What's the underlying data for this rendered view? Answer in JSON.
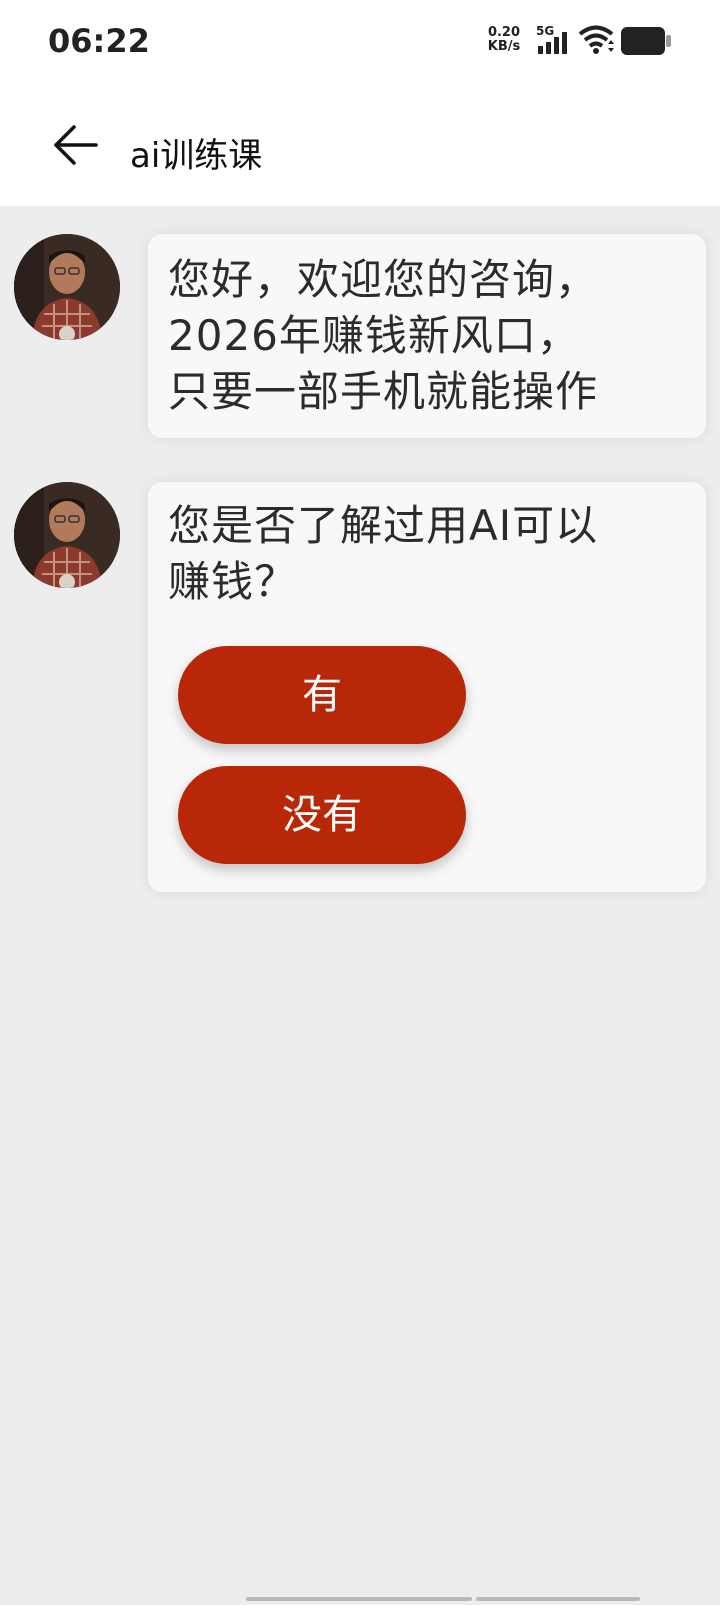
{
  "status_bar": {
    "time": "06:22",
    "net_speed_value": "0.20",
    "net_speed_unit": "KB/s",
    "signal_label": "5G"
  },
  "app_bar": {
    "title": "ai训练课"
  },
  "messages": [
    {
      "lines": [
        "您好，欢迎您的咨询，",
        "2026年赚钱新风口，",
        "只要一部手机就能操作"
      ]
    },
    {
      "lines": [
        "您是否了解过用AI可以",
        "赚钱？"
      ],
      "choices": [
        "有",
        "没有"
      ]
    }
  ],
  "colors": {
    "accent": "#b72708",
    "background": "#ededed",
    "bubble": "#f8f8f8"
  }
}
